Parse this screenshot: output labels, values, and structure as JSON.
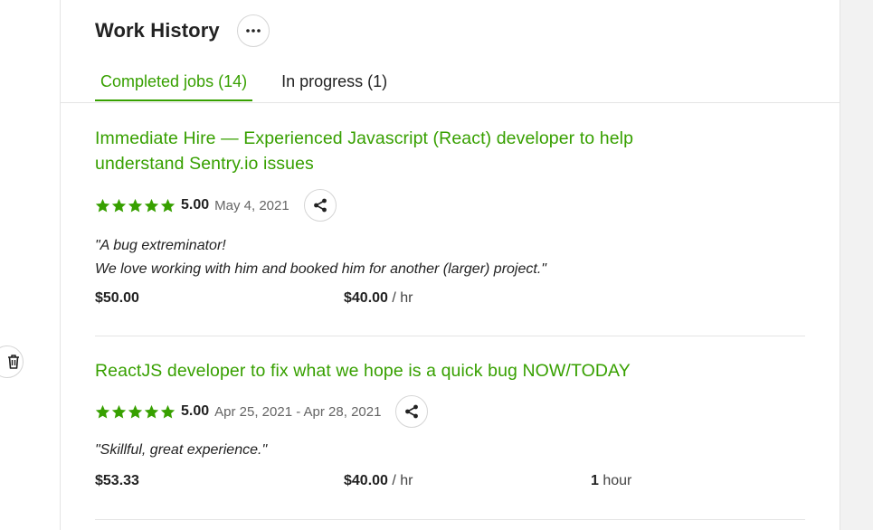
{
  "header": {
    "title": "Work History"
  },
  "tabs": [
    {
      "label": "Completed jobs (14)",
      "active": true
    },
    {
      "label": "In progress (1)",
      "active": false
    }
  ],
  "jobs": [
    {
      "title_line1": "Immediate Hire — Experienced Javascript (React) developer to help",
      "title_line2": "understand Sentry.io issues",
      "stars": 5,
      "score": "5.00",
      "dates": "May 4, 2021",
      "review_line1": "\"A bug extreminator!",
      "review_line2": "We love working with him and booked him for another (larger) project.\"",
      "price": "$50.00",
      "rate": "$40.00",
      "rate_unit": "/ hr",
      "hours": "",
      "hours_unit": ""
    },
    {
      "title_line1": "ReactJS developer to fix what we hope is a quick bug NOW/TODAY",
      "title_line2": "",
      "stars": 5,
      "score": "5.00",
      "dates": "Apr 25, 2021 - Apr 28, 2021",
      "review_line1": "\"Skillful, great experience.\"",
      "review_line2": "",
      "price": "$53.33",
      "rate": "$40.00",
      "rate_unit": "/ hr",
      "hours": "1",
      "hours_unit": "hour"
    }
  ],
  "colors": {
    "accent": "#37a000",
    "text": "#222222",
    "muted": "#656565",
    "border": "#e4e4e4"
  },
  "icons": {
    "more": "ellipsis-icon",
    "share": "share-icon",
    "star": "star-icon",
    "trash": "trash-icon"
  }
}
